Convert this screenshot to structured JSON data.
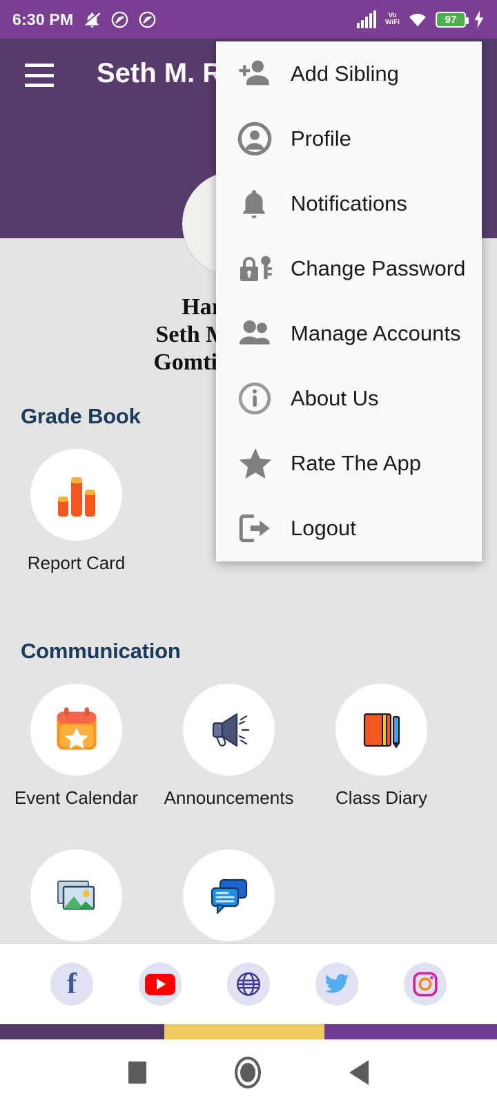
{
  "statusbar": {
    "time": "6:30 PM",
    "battery_percent": "97",
    "vo_line1": "Vo",
    "vo_line2": "WiFi",
    "icons": [
      "mute-icon",
      "do-not-disturb-icon",
      "do-not-disturb-icon",
      "signal-bars-icon",
      "vowifi-icon",
      "wifi-icon",
      "battery-icon",
      "charging-bolt-icon"
    ]
  },
  "appbar": {
    "title": "Seth M. R.",
    "menu_button": "hamburger-menu"
  },
  "profile": {
    "student_name": "Harshita Aga",
    "school_line1": "Seth M. R. Jaipuri",
    "school_line2": "Gomti Nagar Luck"
  },
  "sections": [
    {
      "title": "Grade Book",
      "tiles": [
        {
          "label": "Report Card",
          "icon": "bar-chart-icon"
        }
      ]
    },
    {
      "title": "Communication",
      "tiles": [
        {
          "label": "Event Calendar",
          "icon": "calendar-star-icon"
        },
        {
          "label": "Announcements",
          "icon": "megaphone-icon"
        },
        {
          "label": "Class Diary",
          "icon": "diary-book-icon"
        },
        {
          "label": "",
          "icon": "gallery-icon"
        },
        {
          "label": "",
          "icon": "chat-bubbles-icon"
        }
      ]
    }
  ],
  "footer": {
    "social": [
      {
        "name": "Facebook",
        "icon": "facebook-icon"
      },
      {
        "name": "YouTube",
        "icon": "youtube-icon"
      },
      {
        "name": "Website",
        "icon": "globe-icon"
      },
      {
        "name": "Twitter",
        "icon": "twitter-icon"
      },
      {
        "name": "Instagram",
        "icon": "instagram-icon"
      }
    ]
  },
  "colorstrip": {
    "left": "#55386b",
    "middle": "#eecb5c",
    "right": "#6e3d93"
  },
  "navbar": {
    "recents": "recents-square-icon",
    "home": "home-circle-icon",
    "back": "back-triangle-icon"
  },
  "menu": {
    "items": [
      {
        "label": "Add Sibling",
        "icon": "add-person-icon"
      },
      {
        "label": "Profile",
        "icon": "profile-circle-icon"
      },
      {
        "label": "Notifications",
        "icon": "bell-icon"
      },
      {
        "label": "Change Password",
        "icon": "lock-key-icon"
      },
      {
        "label": "Manage Accounts",
        "icon": "people-icon"
      },
      {
        "label": "About Us",
        "icon": "info-circle-icon"
      },
      {
        "label": "Rate The App",
        "icon": "star-icon"
      },
      {
        "label": "Logout",
        "icon": "logout-arrow-icon"
      }
    ]
  },
  "colors": {
    "statusbar_purple": "#7a3e93",
    "header_purple": "#573c6b",
    "section_title_blue": "#1b3a5c",
    "page_bg": "#e4e4e4"
  }
}
